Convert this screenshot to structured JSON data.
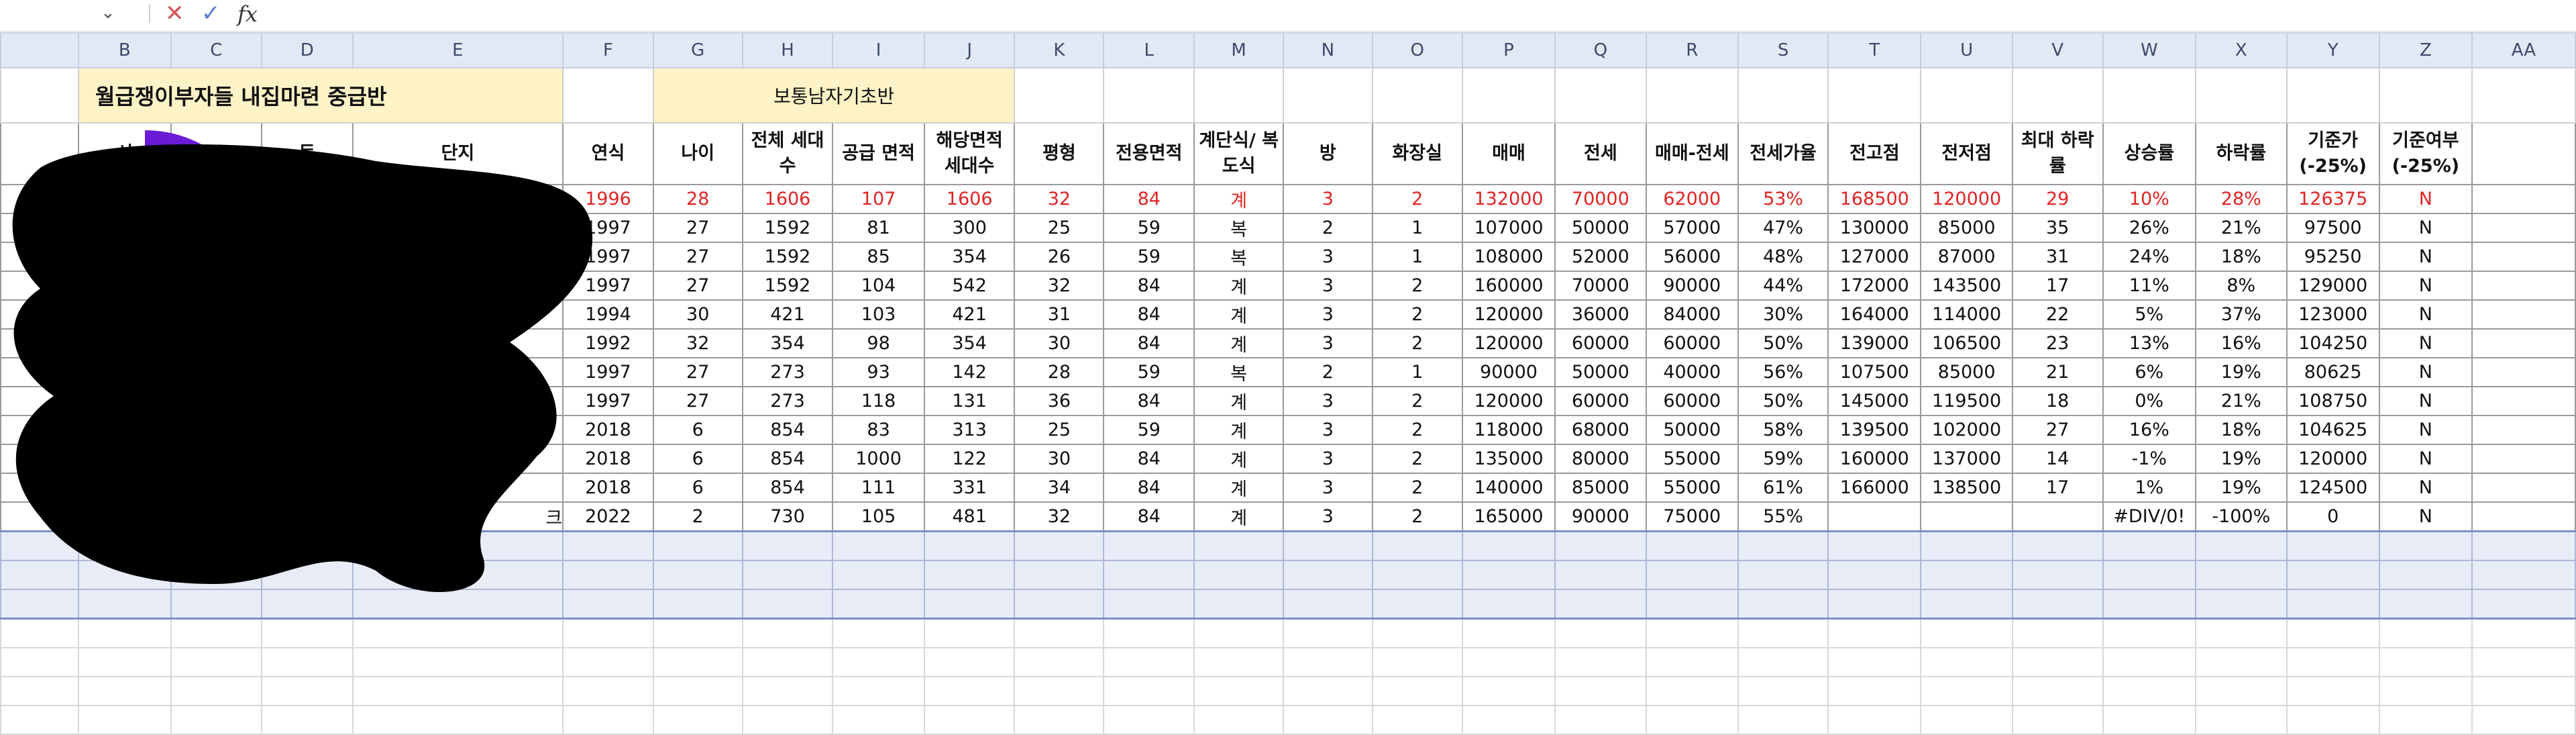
{
  "formula_bar": {
    "fx_label": "fx"
  },
  "columns": [
    "B",
    "C",
    "D",
    "E",
    "F",
    "G",
    "H",
    "I",
    "J",
    "K",
    "L",
    "M",
    "N",
    "O",
    "P",
    "Q",
    "R",
    "S",
    "T",
    "U",
    "V",
    "W",
    "X",
    "Y",
    "Z",
    "AA"
  ],
  "title": "월급쟁이부자들 내집마련 중급반",
  "subtitle": "보통남자기초반",
  "headers": [
    "시",
    "구",
    "동",
    "단지",
    "연식",
    "나이",
    "전체 세대수",
    "공급 면적",
    "해당면적 세대수",
    "평형",
    "전용면적",
    "계단식/ 복도식",
    "방",
    "화장실",
    "매매",
    "전세",
    "매매-전세",
    "전세가율",
    "전고점",
    "전저점",
    "최대 하락률",
    "상승률",
    "하락률",
    "기준가 (-25%)",
    "기준여부 (-25%)"
  ],
  "rows": [
    [
      "1996",
      "28",
      "1606",
      "107",
      "1606",
      "32",
      "84",
      "계",
      "3",
      "2",
      "132000",
      "70000",
      "62000",
      "53%",
      "168500",
      "120000",
      "29",
      "10%",
      "28%",
      "126375",
      "N"
    ],
    [
      "1997",
      "27",
      "1592",
      "81",
      "300",
      "25",
      "59",
      "복",
      "2",
      "1",
      "107000",
      "50000",
      "57000",
      "47%",
      "130000",
      "85000",
      "35",
      "26%",
      "21%",
      "97500",
      "N"
    ],
    [
      "1997",
      "27",
      "1592",
      "85",
      "354",
      "26",
      "59",
      "복",
      "3",
      "1",
      "108000",
      "52000",
      "56000",
      "48%",
      "127000",
      "87000",
      "31",
      "24%",
      "18%",
      "95250",
      "N"
    ],
    [
      "1997",
      "27",
      "1592",
      "104",
      "542",
      "32",
      "84",
      "계",
      "3",
      "2",
      "160000",
      "70000",
      "90000",
      "44%",
      "172000",
      "143500",
      "17",
      "11%",
      "8%",
      "129000",
      "N"
    ],
    [
      "1994",
      "30",
      "421",
      "103",
      "421",
      "31",
      "84",
      "계",
      "3",
      "2",
      "120000",
      "36000",
      "84000",
      "30%",
      "164000",
      "114000",
      "22",
      "5%",
      "37%",
      "123000",
      "N"
    ],
    [
      "1992",
      "32",
      "354",
      "98",
      "354",
      "30",
      "84",
      "계",
      "3",
      "2",
      "120000",
      "60000",
      "60000",
      "50%",
      "139000",
      "106500",
      "23",
      "13%",
      "16%",
      "104250",
      "N"
    ],
    [
      "1997",
      "27",
      "273",
      "93",
      "142",
      "28",
      "59",
      "복",
      "2",
      "1",
      "90000",
      "50000",
      "40000",
      "56%",
      "107500",
      "85000",
      "21",
      "6%",
      "19%",
      "80625",
      "N"
    ],
    [
      "1997",
      "27",
      "273",
      "118",
      "131",
      "36",
      "84",
      "계",
      "3",
      "2",
      "120000",
      "60000",
      "60000",
      "50%",
      "145000",
      "119500",
      "18",
      "0%",
      "21%",
      "108750",
      "N"
    ],
    [
      "2018",
      "6",
      "854",
      "83",
      "313",
      "25",
      "59",
      "계",
      "3",
      "2",
      "118000",
      "68000",
      "50000",
      "58%",
      "139500",
      "102000",
      "27",
      "16%",
      "18%",
      "104625",
      "N"
    ],
    [
      "2018",
      "6",
      "854",
      "1000",
      "122",
      "30",
      "84",
      "계",
      "3",
      "2",
      "135000",
      "80000",
      "55000",
      "59%",
      "160000",
      "137000",
      "14",
      "-1%",
      "19%",
      "120000",
      "N"
    ],
    [
      "2018",
      "6",
      "854",
      "111",
      "331",
      "34",
      "84",
      "계",
      "3",
      "2",
      "140000",
      "85000",
      "55000",
      "61%",
      "166000",
      "138500",
      "17",
      "1%",
      "19%",
      "124500",
      "N"
    ],
    [
      "2022",
      "2",
      "730",
      "105",
      "481",
      "32",
      "84",
      "계",
      "3",
      "2",
      "165000",
      "90000",
      "75000",
      "55%",
      "",
      "",
      "",
      "#DIV/0!",
      "-100%",
      "0",
      "N"
    ]
  ],
  "partial_cell_char": "크"
}
